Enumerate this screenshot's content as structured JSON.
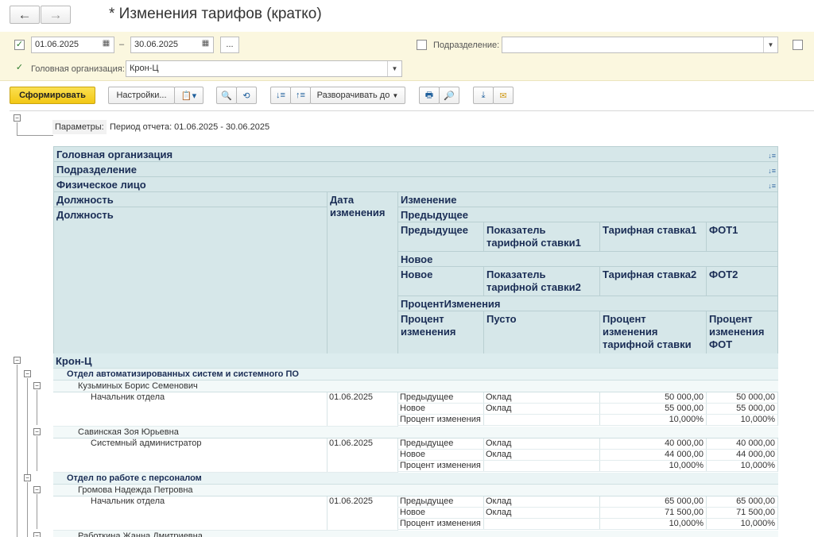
{
  "window": {
    "title": "* Изменения тарифов (кратко)"
  },
  "nav": {
    "back_icon": "←",
    "forward_icon": "→"
  },
  "filters": {
    "period_checked": true,
    "date_from": "01.06.2025",
    "date_sep": "–",
    "date_to": "30.06.2025",
    "more_label": "...",
    "department_label": "Подразделение:",
    "department_value": "",
    "org_checked": true,
    "org_label": "Головная организация:",
    "org_value": "Крон-Ц"
  },
  "toolbar": {
    "generate": "Сформировать",
    "settings": "Настройки...",
    "expand_to": "Разворачивать до"
  },
  "report": {
    "params_label": "Параметры:",
    "params_value": "Период отчета: 01.06.2025 - 30.06.2025",
    "headers": {
      "org": "Головная организация",
      "dept": "Подразделение",
      "person": "Физическое лицо",
      "position1": "Должность",
      "position2": "Должность",
      "date": "Дата изменения",
      "change": "Изменение",
      "prev_group": "Предыдущее",
      "prev": "Предыдущее",
      "rate_ind1": "Показатель тарифной ставки1",
      "rate1": "Тарифная ставка1",
      "fot1": "ФОТ1",
      "new_group": "Новое",
      "new": "Новое",
      "rate_ind2": "Показатель тарифной ставки2",
      "rate2": "Тарифная ставка2",
      "fot2": "ФОТ2",
      "pct_group": "ПроцентИзменения",
      "pct": "Процент изменения",
      "empty": "Пусто",
      "pct_rate": "Процент изменения тарифной ставки",
      "pct_fot": "Процент изменения ФОТ"
    },
    "org": "Крон-Ц",
    "depts": [
      {
        "name": "Отдел автоматизированных систем и системного ПО",
        "people": [
          {
            "name": "Кузьминых Борис Семенович",
            "position": "Начальник отдела",
            "date": "01.06.2025",
            "rows": [
              {
                "kind": "Предыдущее",
                "ind": "Оклад",
                "rate": "50 000,00",
                "fot": "50 000,00"
              },
              {
                "kind": "Новое",
                "ind": "Оклад",
                "rate": "55 000,00",
                "fot": "55 000,00"
              },
              {
                "kind": "Процент изменения",
                "ind": "",
                "rate": "10,000%",
                "fot": "10,000%"
              }
            ]
          },
          {
            "name": "Савинская Зоя Юрьевна",
            "position": "Системный администратор",
            "date": "01.06.2025",
            "rows": [
              {
                "kind": "Предыдущее",
                "ind": "Оклад",
                "rate": "40 000,00",
                "fot": "40 000,00"
              },
              {
                "kind": "Новое",
                "ind": "Оклад",
                "rate": "44 000,00",
                "fot": "44 000,00"
              },
              {
                "kind": "Процент изменения",
                "ind": "",
                "rate": "10,000%",
                "fot": "10,000%"
              }
            ]
          }
        ]
      },
      {
        "name": "Отдел по работе с персоналом",
        "people": [
          {
            "name": "Громова Надежда Петровна",
            "position": "Начальник отдела",
            "date": "01.06.2025",
            "rows": [
              {
                "kind": "Предыдущее",
                "ind": "Оклад",
                "rate": "65 000,00",
                "fot": "65 000,00"
              },
              {
                "kind": "Новое",
                "ind": "Оклад",
                "rate": "71 500,00",
                "fot": "71 500,00"
              },
              {
                "kind": "Процент изменения",
                "ind": "",
                "rate": "10,000%",
                "fot": "10,000%"
              }
            ]
          },
          {
            "name": "Работкина Жанна Дмитриевна"
          }
        ]
      }
    ]
  }
}
